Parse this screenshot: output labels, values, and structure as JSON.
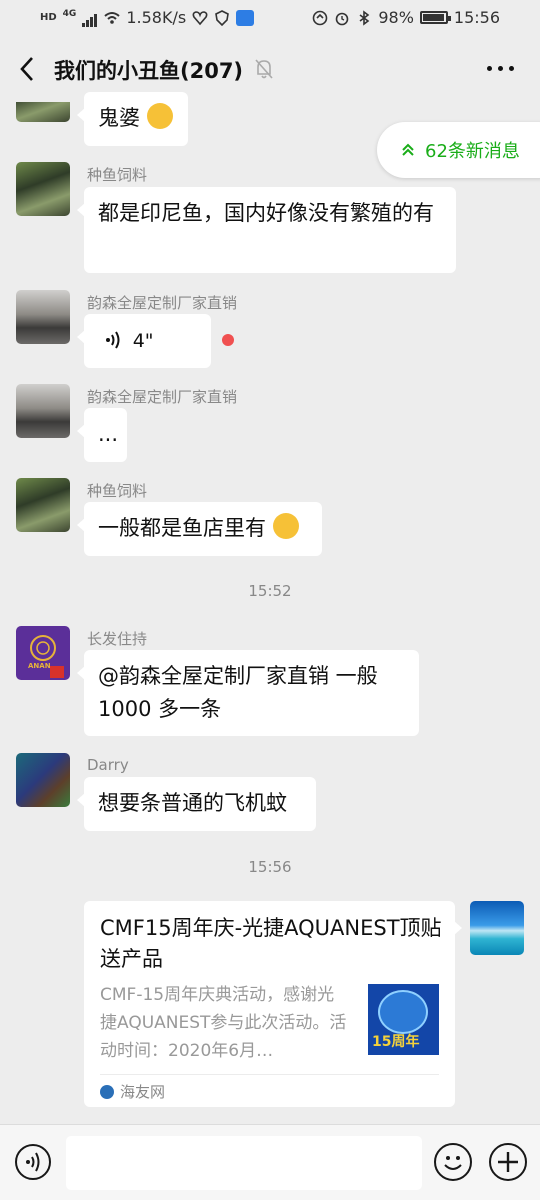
{
  "status": {
    "net_badge": "HD",
    "net_type": "4G",
    "speed": "1.58K/s",
    "battery": "98%",
    "time": "15:56"
  },
  "header": {
    "title": "我们的小丑鱼(207)"
  },
  "new_messages": "62条新消息",
  "messages": {
    "m0": {
      "text": "鬼婆"
    },
    "m1": {
      "nick": "种鱼饲料",
      "text": "都是印尼鱼，国内好像没有繁殖的有"
    },
    "m2": {
      "nick": "韵森全屋定制厂家直销",
      "voice": "4\""
    },
    "m3": {
      "nick": "韵森全屋定制厂家直销",
      "text": "..."
    },
    "m4": {
      "nick": "种鱼饲料",
      "text": "一般都是鱼店里有"
    },
    "t1": "15:52",
    "m5": {
      "nick": "长发住持",
      "text_l1": "@韵森全屋定制厂家直销  一般",
      "text_l2": "1000 多一条",
      "avatar_text": "ANAN"
    },
    "m6": {
      "nick": "Darry",
      "text": "想要条普通的飞机蚊"
    },
    "t2": "15:56",
    "card": {
      "title": "CMF15周年庆-光捷AQUANEST顶贴送产品",
      "desc": "CMF-15周年庆典活动，感谢光捷AQUANEST参与此次活动。活动时间：2020年6月…",
      "thumb_text": "15周年",
      "source": "海友网"
    }
  }
}
